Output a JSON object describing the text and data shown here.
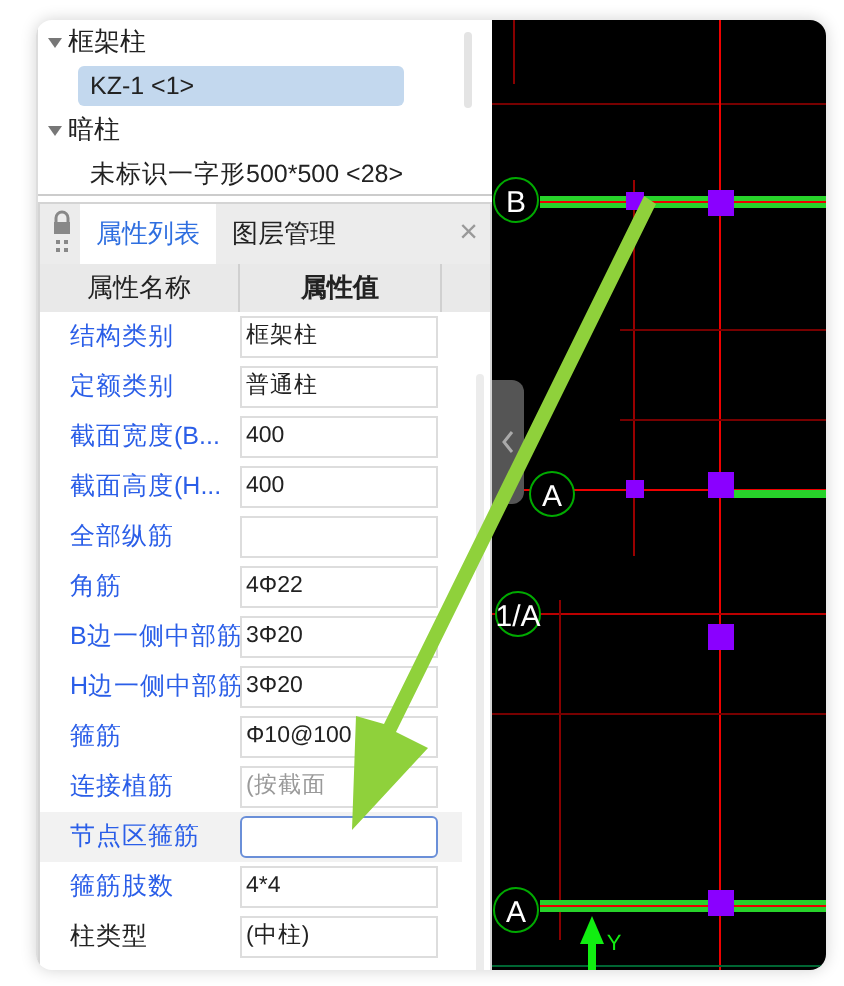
{
  "tree": [
    {
      "label": "框架柱",
      "expanded": true,
      "children": [
        {
          "label": "KZ-1 <1>",
          "selected": true
        }
      ]
    },
    {
      "label": "暗柱",
      "expanded": true,
      "children": [
        {
          "label": "未标识一字形500*500 <28>",
          "selected": false
        }
      ]
    }
  ],
  "tabs": [
    {
      "label": "属性列表",
      "selected": true
    },
    {
      "label": "图层管理",
      "selected": false
    }
  ],
  "close": "×",
  "columns": [
    "属性名称",
    "属性值"
  ],
  "rows": [
    {
      "kind": "link",
      "name": "结构类别",
      "value": "框架柱",
      "selected": false
    },
    {
      "kind": "link",
      "name": "定额类别",
      "value": "普通柱",
      "selected": false
    },
    {
      "kind": "link",
      "name": "截面宽度(B...",
      "value": "400",
      "selected": false
    },
    {
      "kind": "link",
      "name": "截面高度(H...",
      "value": "400",
      "selected": false
    },
    {
      "kind": "link",
      "name": "全部纵筋",
      "selected": false
    },
    {
      "kind": "link",
      "name": "角筋",
      "value": "4Φ22",
      "selected": false
    },
    {
      "kind": "link",
      "name": "B边一侧中部筋",
      "value": "3Φ20",
      "selected": false
    },
    {
      "kind": "link",
      "name": "H边一侧中部筋",
      "value": "3Φ20",
      "selected": false
    },
    {
      "kind": "link",
      "name": "箍筋",
      "value": "Φ10@100",
      "selected": false
    },
    {
      "kind": "link",
      "name": "连接植筋",
      "placeholder": "(按截面",
      "selected": false
    },
    {
      "kind": "link",
      "name": "节点区箍筋",
      "selected": true
    },
    {
      "kind": "link",
      "name": "箍筋肢数",
      "value": "4*4",
      "selected": false
    },
    {
      "kind": "plain",
      "name": "柱类型",
      "value": "(中柱)",
      "selected": false
    }
  ],
  "canvas": {
    "axis_labels": [
      "B",
      "A",
      "1/A",
      "A"
    ],
    "axis_y": "Y"
  }
}
